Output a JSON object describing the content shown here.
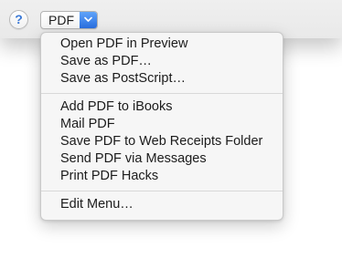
{
  "help_button": {
    "label": "?"
  },
  "pdf_button": {
    "label": "PDF",
    "arrow_icon": "chevron-down-icon"
  },
  "menu": {
    "group1": [
      {
        "label": "Open PDF in Preview"
      },
      {
        "label": "Save as PDF…"
      },
      {
        "label": "Save as PostScript…"
      }
    ],
    "group2": [
      {
        "label": "Add PDF to iBooks"
      },
      {
        "label": "Mail PDF"
      },
      {
        "label": "Save PDF to Web Receipts Folder"
      },
      {
        "label": "Send PDF via Messages"
      },
      {
        "label": "Print PDF Hacks"
      }
    ],
    "group3": [
      {
        "label": "Edit Menu…"
      }
    ]
  },
  "colors": {
    "accent": "#2a6fe0",
    "help_glyph": "#3a78d6",
    "menu_background": "#f6f6f6",
    "toolbar_background": "#ececec"
  }
}
